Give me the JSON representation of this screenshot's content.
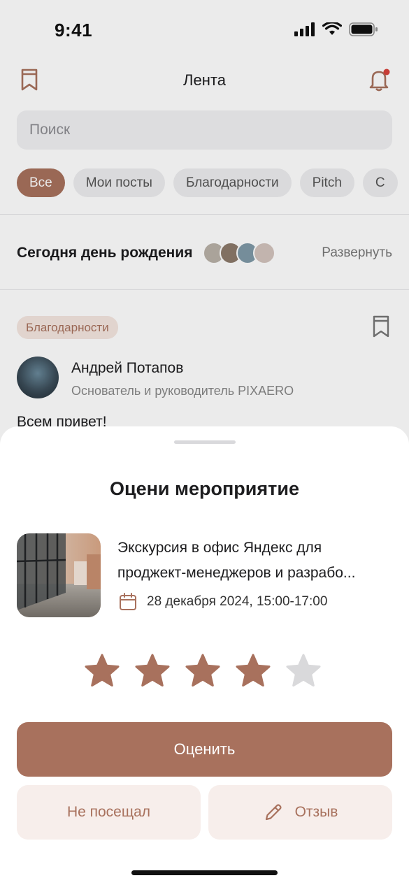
{
  "status_bar": {
    "time": "9:41"
  },
  "header": {
    "title": "Лента"
  },
  "search": {
    "placeholder": "Поиск"
  },
  "filters": [
    {
      "label": "Все",
      "active": true
    },
    {
      "label": "Мои посты"
    },
    {
      "label": "Благодарности"
    },
    {
      "label": "Pitch"
    },
    {
      "label": "С"
    }
  ],
  "birthday": {
    "title": "Сегодня день рождения",
    "expand_label": "Развернуть"
  },
  "post": {
    "tag": "Благодарности",
    "author_name": "Андрей Потапов",
    "author_role": "Основатель и руководитель PIXAERO",
    "text": "Всем привет!"
  },
  "rating_sheet": {
    "title": "Оцени мероприятие",
    "event": {
      "title_line1": "Экскурсия в офис Яндекс для",
      "title_line2": "проджект-менеджеров и разрабо...",
      "date": "28 декабря 2024, 15:00-17:00"
    },
    "rating": {
      "value": 4,
      "max": 5
    },
    "submit_label": "Оценить",
    "not_attended_label": "Не посещал",
    "review_label": "Отзыв"
  },
  "colors": {
    "accent": "#a8715d",
    "star_inactive": "#d9d9db",
    "secondary_bg": "#f7eeeb"
  },
  "icons": [
    "bookmark-icon",
    "bell-icon",
    "calendar-icon",
    "pencil-icon",
    "star-icon"
  ]
}
